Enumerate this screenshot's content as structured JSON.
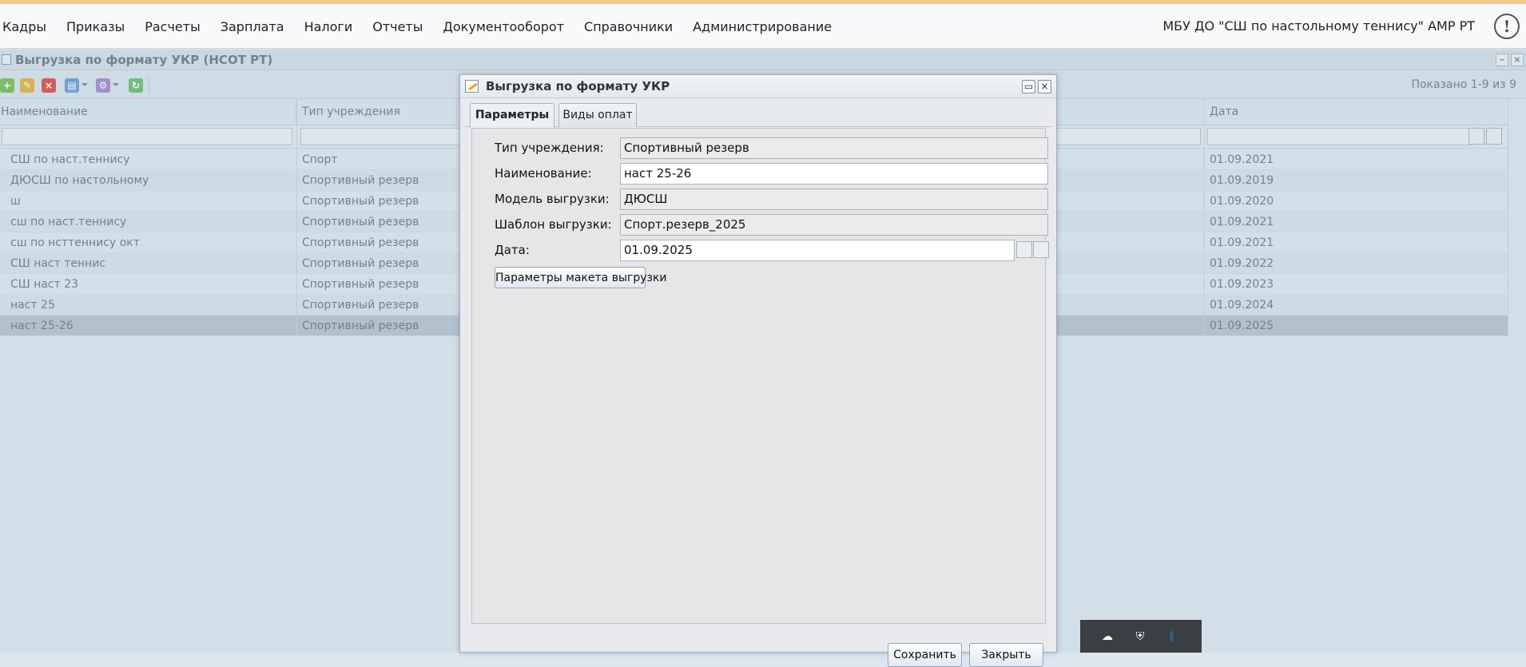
{
  "menu": {
    "items": [
      "Кадры",
      "Приказы",
      "Расчеты",
      "Зарплата",
      "Налоги",
      "Отчеты",
      "Документооборот",
      "Справочники",
      "Администрирование"
    ],
    "org_name": "МБУ ДО \"СШ по настольному теннису\" АМР РТ",
    "alert_glyph": "!"
  },
  "window": {
    "title": "Выгрузка по формату УКР (НСОТ РТ)",
    "shown_text": "Показано 1-9 из 9"
  },
  "grid": {
    "columns": [
      "Наименование",
      "Тип учреждения",
      "Дата"
    ],
    "rows": [
      {
        "name": "СШ по наст.теннису",
        "type": "Спорт",
        "date": "01.09.2021"
      },
      {
        "name": "ДЮСШ по настольному",
        "type": "Спортивный резерв",
        "date": "01.09.2019"
      },
      {
        "name": "ш",
        "type": "Спортивный резерв",
        "date": "01.09.2020"
      },
      {
        "name": "сш по наст.теннису",
        "type": "Спортивный резерв",
        "date": "01.09.2021"
      },
      {
        "name": "сш по нсттеннису окт",
        "type": "Спортивный резерв",
        "date": "01.09.2021"
      },
      {
        "name": "СШ наст теннис",
        "type": "Спортивный резерв",
        "date": "01.09.2022"
      },
      {
        "name": "СШ наст 23",
        "type": "Спортивный резерв",
        "date": "01.09.2023"
      },
      {
        "name": "наст 25",
        "type": "Спортивный резерв",
        "date": "01.09.2024"
      },
      {
        "name": "наст 25-26",
        "type": "Спортивный резерв",
        "date": "01.09.2025"
      }
    ],
    "selected_index": 8
  },
  "dialog": {
    "title": "Выгрузка по формату УКР",
    "tabs": [
      "Параметры",
      "Виды оплат"
    ],
    "active_tab": "Параметры",
    "fields": {
      "type_label": "Тип учреждения:",
      "type_value": "Спортивный резерв",
      "name_label": "Наименование:",
      "name_value": "наст 25-26",
      "model_label": "Модель выгрузки:",
      "model_value": "ДЮСШ",
      "template_label": "Шаблон выгрузки:",
      "template_value": "Спорт.резерв_2025",
      "date_label": "Дата:",
      "date_value": "01.09.2025"
    },
    "layout_params_button": "Параметры макета выгрузки",
    "save_button": "Сохранить",
    "close_button": "Закрыть"
  },
  "colors": {
    "accent_stripe": "#f3c98e",
    "selected_row": "#b7c4d0"
  }
}
